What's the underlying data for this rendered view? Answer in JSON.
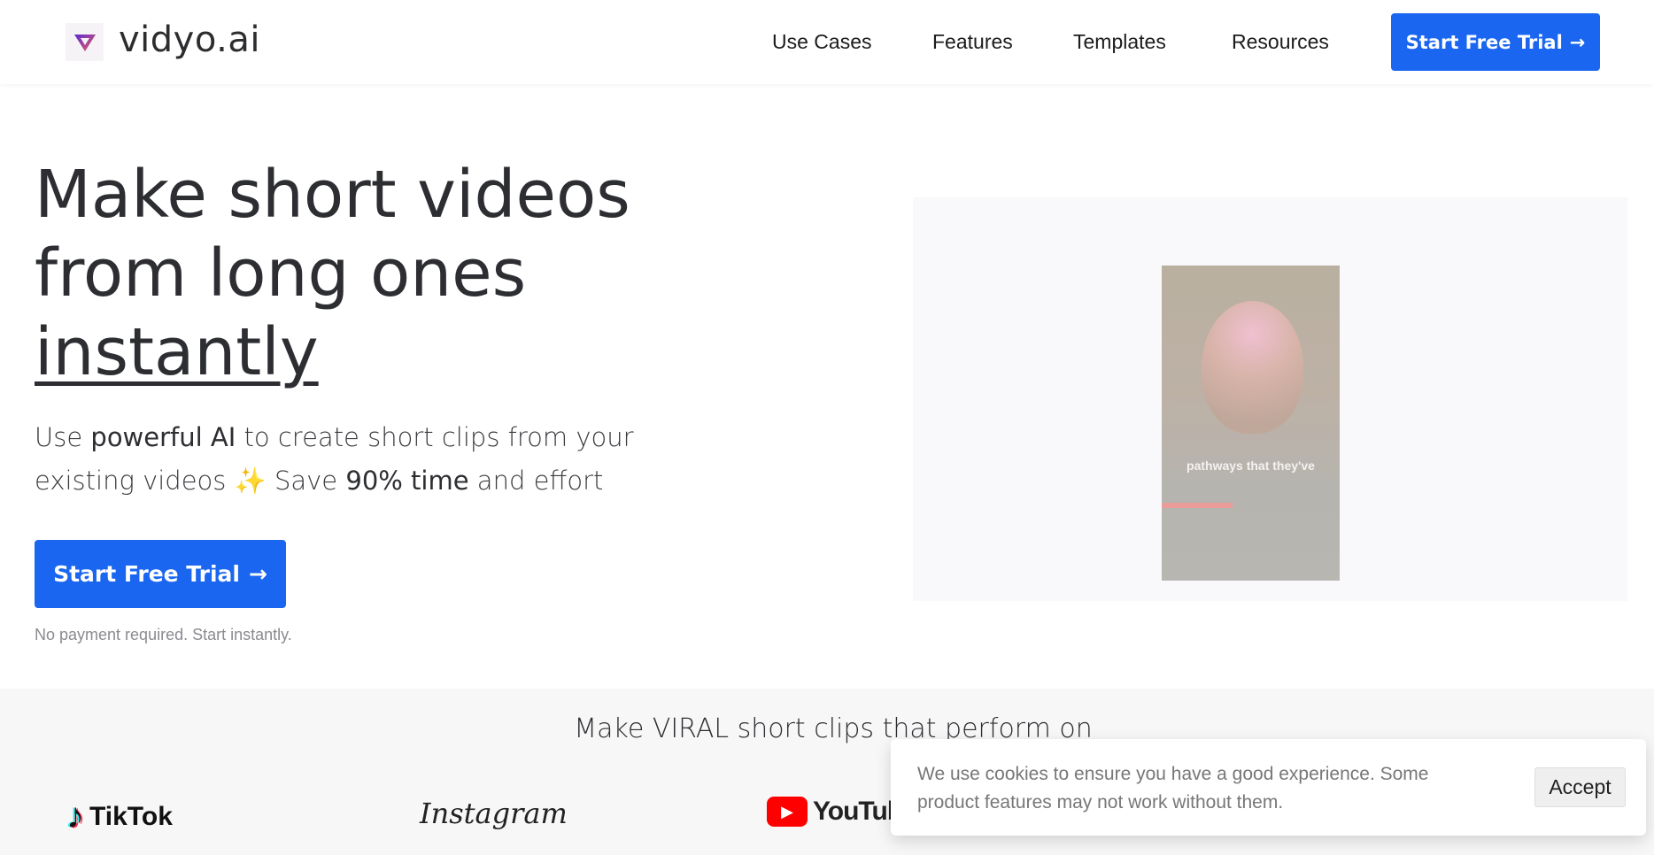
{
  "header": {
    "brand": "vidyo.ai",
    "nav": [
      "Use Cases",
      "Features",
      "Templates",
      "Resources"
    ],
    "cta_label": "Start Free Trial",
    "cta_icon": "arrow-right-icon"
  },
  "hero": {
    "title_line1": "Make short videos",
    "title_line2": "from long ones",
    "title_line3": "instantly",
    "sub_1": "Use ",
    "sub_2": "powerful AI",
    "sub_3": " to create short clips from your existing videos ",
    "sub_emoji": "✨",
    "sub_4": " Save ",
    "sub_5": "90% time",
    "sub_6": " and effort",
    "cta_label": "Start Free Trial",
    "note": "No payment required. Start instantly.",
    "video_caption": "pathways that they've",
    "video_progress": 0.4
  },
  "platforms": {
    "title": "Make VIRAL short clips that perform on",
    "items": [
      "TikTok",
      "Instagram",
      "YouTube"
    ]
  },
  "cookie": {
    "text": "We use cookies to ensure you have a good experience. Some product features may not work without them.",
    "accept_label": "Accept"
  },
  "colors": {
    "accent": "#1a66f0",
    "background_band": "#f7f7f7"
  }
}
